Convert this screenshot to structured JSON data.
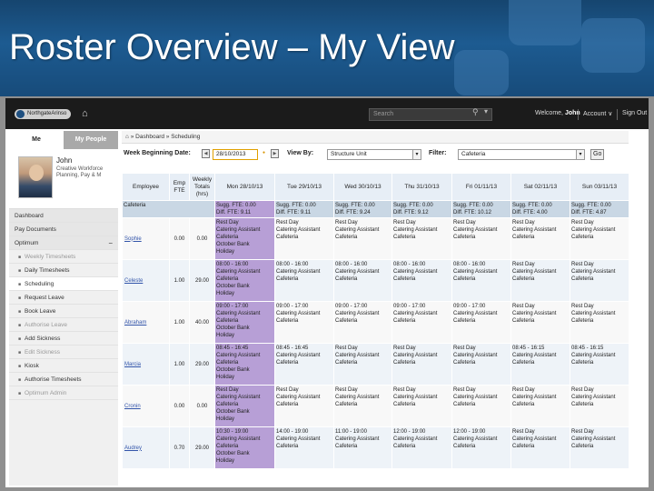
{
  "slide": {
    "title": "Roster Overview – My View"
  },
  "topbar": {
    "logo": "NorthgateArinso",
    "search_placeholder": "Search",
    "welcome_prefix": "Welcome,",
    "welcome_name": "John",
    "account": "Account ∨",
    "signout": "Sign Out"
  },
  "sidebar": {
    "tabs": [
      "Me",
      "My People"
    ],
    "profile": {
      "name": "John",
      "role": "Creative Workforce Planning, Pay & M"
    },
    "items": [
      {
        "label": "Dashboard",
        "type": "head"
      },
      {
        "label": "Pay Documents",
        "type": "head"
      },
      {
        "label": "Optimum",
        "type": "head",
        "collapse": "−"
      },
      {
        "label": "Weekly Timesheets",
        "type": "sub",
        "state": "disabled"
      },
      {
        "label": "Daily Timesheets",
        "type": "sub"
      },
      {
        "label": "Scheduling",
        "type": "sub",
        "state": "sel"
      },
      {
        "label": "Request Leave",
        "type": "sub"
      },
      {
        "label": "Book Leave",
        "type": "sub"
      },
      {
        "label": "Authorise Leave",
        "type": "sub",
        "state": "disabled"
      },
      {
        "label": "Add Sickness",
        "type": "sub"
      },
      {
        "label": "Edit Sickness",
        "type": "sub",
        "state": "disabled"
      },
      {
        "label": "Kiosk",
        "type": "sub"
      },
      {
        "label": "Authorise Timesheets",
        "type": "sub"
      },
      {
        "label": "Optimum Admin",
        "type": "sub",
        "state": "disabled"
      }
    ]
  },
  "breadcrumb": {
    "home": "⌂",
    "items": "» Dashboard » Scheduling"
  },
  "filters": {
    "week_label": "Week Beginning Date:",
    "week_value": "28/10/2013",
    "view_label": "View By:",
    "view_value": "Structure Unit",
    "filter_label": "Filter:",
    "filter_value": "Cafeteria",
    "go": "Go"
  },
  "roster": {
    "headers": [
      "Employee",
      "Emp FTE",
      "Weekly Totals (hrs)",
      "Mon 28/10/13",
      "Tue 29/10/13",
      "Wed 30/10/13",
      "Thu 31/10/13",
      "Fri 01/11/13",
      "Sat 02/11/13",
      "Sun 03/11/13"
    ],
    "dept": "Cafeteria",
    "summary": [
      {
        "sugg": "Sugg. FTE: 0.00",
        "diff": "Diff. FTE: 9.11"
      },
      {
        "sugg": "Sugg. FTE: 0.00",
        "diff": "Diff. FTE: 9.11"
      },
      {
        "sugg": "Sugg. FTE: 0.00",
        "diff": "Diff. FTE: 9.24"
      },
      {
        "sugg": "Sugg. FTE: 0.00",
        "diff": "Diff. FTE: 9.12"
      },
      {
        "sugg": "Sugg. FTE: 0.00",
        "diff": "Diff. FTE: 10.12"
      },
      {
        "sugg": "Sugg. FTE: 0.00",
        "diff": "Diff. FTE: 4.00"
      },
      {
        "sugg": "Sugg. FTE: 0.00",
        "diff": "Diff. FTE: 4.87"
      }
    ],
    "rows": [
      {
        "name": "Sophie",
        "fte": "0.00",
        "hours": "0.00",
        "days": [
          {
            "lines": [
              "Rest Day",
              "Catering Assistant",
              "Cafeteria",
              "October Bank",
              "Holiday"
            ],
            "kind": "hol"
          },
          {
            "lines": [
              "Rest Day",
              "Catering Assistant",
              "Cafeteria"
            ],
            "kind": "rest"
          },
          {
            "lines": [
              "Rest Day",
              "Catering Assistant",
              "Cafeteria"
            ],
            "kind": "rest"
          },
          {
            "lines": [
              "Rest Day",
              "Catering Assistant",
              "Cafeteria"
            ],
            "kind": "rest"
          },
          {
            "lines": [
              "Rest Day",
              "Catering Assistant",
              "Cafeteria"
            ],
            "kind": "rest"
          },
          {
            "lines": [
              "Rest Day",
              "Catering Assistant",
              "Cafeteria"
            ],
            "kind": "rest"
          },
          {
            "lines": [
              "Rest Day",
              "Catering Assistant",
              "Cafeteria"
            ],
            "kind": "rest"
          }
        ]
      },
      {
        "name": "Celeste",
        "fte": "1.00",
        "hours": "29.00",
        "days": [
          {
            "lines": [
              "08:00 - 16:00",
              "Catering Assistant",
              "Cafeteria",
              "October Bank",
              "Holiday"
            ],
            "kind": "hol"
          },
          {
            "lines": [
              "08:00 - 16:00",
              "Catering Assistant",
              "Cafeteria"
            ],
            "kind": "shift"
          },
          {
            "lines": [
              "08:00 - 16:00",
              "Catering Assistant",
              "Cafeteria"
            ],
            "kind": "shift"
          },
          {
            "lines": [
              "08:00 - 16:00",
              "Catering Assistant",
              "Cafeteria"
            ],
            "kind": "shift"
          },
          {
            "lines": [
              "08:00 - 16:00",
              "Catering Assistant",
              "Cafeteria"
            ],
            "kind": "shift"
          },
          {
            "lines": [
              "Rest Day",
              "Catering Assistant",
              "Cafeteria"
            ],
            "kind": "rest"
          },
          {
            "lines": [
              "Rest Day",
              "Catering Assistant",
              "Cafeteria"
            ],
            "kind": "rest"
          }
        ]
      },
      {
        "name": "Abraham",
        "fte": "1.00",
        "hours": "40.00",
        "days": [
          {
            "lines": [
              "09:00 - 17:00",
              "Catering Assistant",
              "Cafeteria",
              "October Bank",
              "Holiday"
            ],
            "kind": "hol"
          },
          {
            "lines": [
              "09:00 - 17:00",
              "Catering Assistant",
              "Cafeteria"
            ],
            "kind": "shift"
          },
          {
            "lines": [
              "09:00 - 17:00",
              "Catering Assistant",
              "Cafeteria"
            ],
            "kind": "shift"
          },
          {
            "lines": [
              "09:00 - 17:00",
              "Catering Assistant",
              "Cafeteria"
            ],
            "kind": "shift"
          },
          {
            "lines": [
              "09:00 - 17:00",
              "Catering Assistant",
              "Cafeteria"
            ],
            "kind": "shift"
          },
          {
            "lines": [
              "Rest Day",
              "Catering Assistant",
              "Cafeteria"
            ],
            "kind": "rest"
          },
          {
            "lines": [
              "Rest Day",
              "Catering Assistant",
              "Cafeteria"
            ],
            "kind": "rest"
          }
        ]
      },
      {
        "name": "Marcia",
        "fte": "1.00",
        "hours": "29.00",
        "days": [
          {
            "lines": [
              "08:45 - 16:45",
              "Catering Assistant",
              "Cafeteria",
              "October Bank",
              "Holiday"
            ],
            "kind": "hol"
          },
          {
            "lines": [
              "08:45 - 16:45",
              "Catering Assistant",
              "Cafeteria"
            ],
            "kind": "shift"
          },
          {
            "lines": [
              "Rest Day",
              "Catering Assistant",
              "Cafeteria"
            ],
            "kind": "rest"
          },
          {
            "lines": [
              "Rest Day",
              "Catering Assistant",
              "Cafeteria"
            ],
            "kind": "rest"
          },
          {
            "lines": [
              "Rest Day",
              "Catering Assistant",
              "Cafeteria"
            ],
            "kind": "rest"
          },
          {
            "lines": [
              "08:45 - 16:15",
              "Catering Assistant",
              "Cafeteria"
            ],
            "kind": "shift"
          },
          {
            "lines": [
              "08:45 - 16:15",
              "Catering Assistant",
              "Cafeteria"
            ],
            "kind": "shift"
          }
        ]
      },
      {
        "name": "Cronin",
        "fte": "0.00",
        "hours": "0.00",
        "days": [
          {
            "lines": [
              "Rest Day",
              "Catering Assistant",
              "Cafeteria",
              "October Bank",
              "Holiday"
            ],
            "kind": "hol"
          },
          {
            "lines": [
              "Rest Day",
              "Catering Assistant",
              "Cafeteria"
            ],
            "kind": "rest"
          },
          {
            "lines": [
              "Rest Day",
              "Catering Assistant",
              "Cafeteria"
            ],
            "kind": "rest"
          },
          {
            "lines": [
              "Rest Day",
              "Catering Assistant",
              "Cafeteria"
            ],
            "kind": "rest"
          },
          {
            "lines": [
              "Rest Day",
              "Catering Assistant",
              "Cafeteria"
            ],
            "kind": "rest"
          },
          {
            "lines": [
              "Rest Day",
              "Catering Assistant",
              "Cafeteria"
            ],
            "kind": "rest"
          },
          {
            "lines": [
              "Rest Day",
              "Catering Assistant",
              "Cafeteria"
            ],
            "kind": "rest"
          }
        ]
      },
      {
        "name": "Audrey",
        "fte": "0.70",
        "hours": "29.00",
        "days": [
          {
            "lines": [
              "10:30 - 19:00",
              "Catering Assistant",
              "Cafeteria",
              "October Bank",
              "Holiday"
            ],
            "kind": "hol"
          },
          {
            "lines": [
              "14:00 - 19:00",
              "Catering Assistant",
              "Cafeteria"
            ],
            "kind": "shift"
          },
          {
            "lines": [
              "11:00 - 19:00",
              "Catering Assistant",
              "Cafeteria"
            ],
            "kind": "shift"
          },
          {
            "lines": [
              "12:00 - 19:00",
              "Catering Assistant",
              "Cafeteria"
            ],
            "kind": "shift"
          },
          {
            "lines": [
              "12:00 - 19:00",
              "Catering Assistant",
              "Cafeteria"
            ],
            "kind": "shift"
          },
          {
            "lines": [
              "Rest Day",
              "Catering Assistant",
              "Cafeteria"
            ],
            "kind": "rest"
          },
          {
            "lines": [
              "Rest Day",
              "Catering Assistant",
              "Cafeteria"
            ],
            "kind": "rest"
          }
        ]
      }
    ]
  }
}
